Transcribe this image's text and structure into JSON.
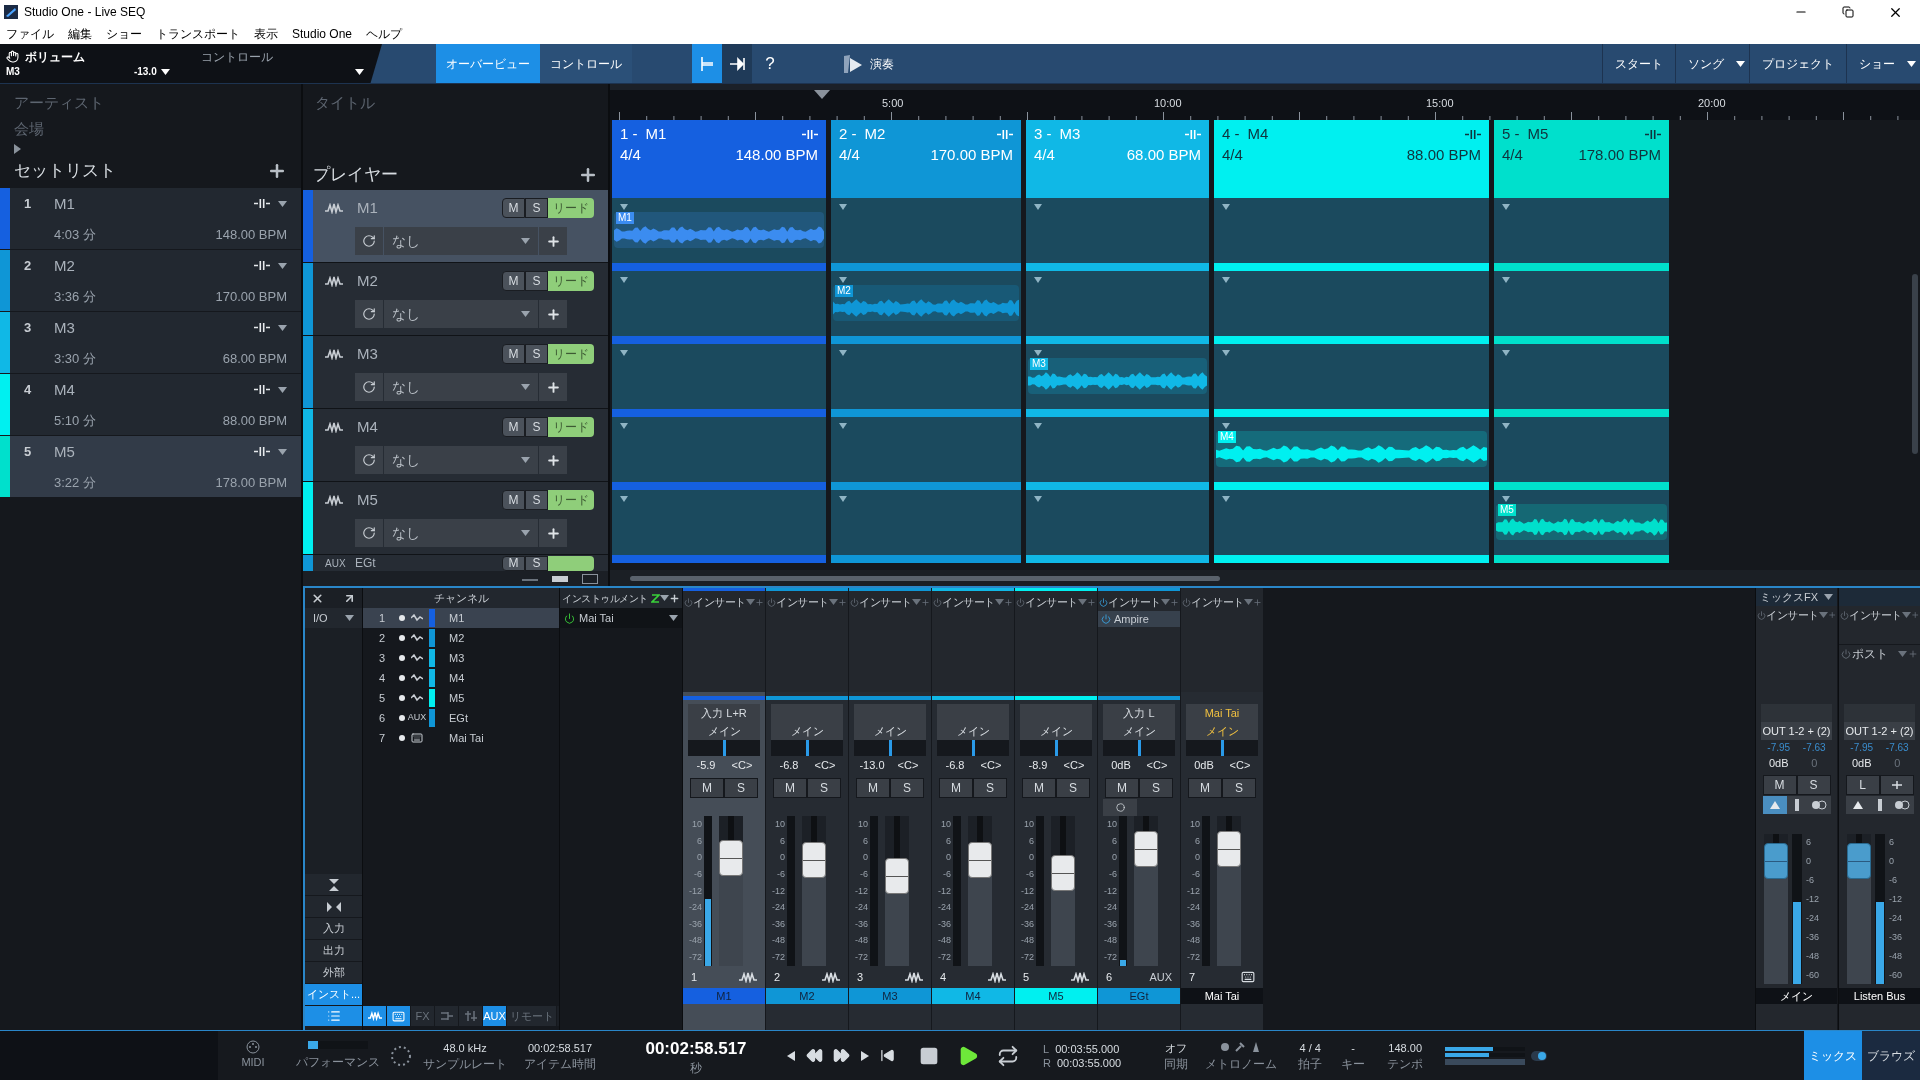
{
  "window": {
    "title": "Studio One - Live SEQ"
  },
  "menu": [
    "ファイル",
    "編集",
    "ショー",
    "トランスポート",
    "表示",
    "Studio One",
    "ヘルプ"
  ],
  "toolbar": {
    "parameter": "ボリューム",
    "track": "M3",
    "value": "-13.0",
    "control": "コントロール",
    "tabs": [
      {
        "label": "オーバービュー",
        "selected": true
      },
      {
        "label": "コントロール",
        "selected": false
      }
    ],
    "tools": [
      {
        "kind": "snap",
        "selected": true
      },
      {
        "kind": "follow",
        "selected": false
      }
    ],
    "help": "?",
    "perform": "演奏",
    "pages": [
      {
        "label": "スタート",
        "menu": false
      },
      {
        "label": "ソング",
        "menu": true
      },
      {
        "label": "プロジェクト",
        "menu": false
      },
      {
        "label": "ショー",
        "menu": true
      }
    ]
  },
  "show": {
    "artist_placeholder": "アーティスト",
    "venue_placeholder": "会場",
    "title_placeholder": "タイトル"
  },
  "setlist": {
    "title": "セットリスト",
    "items": [
      {
        "number": "1",
        "name": "M1",
        "duration": "4:03 分",
        "bpm": "148.00 BPM",
        "color": "#1560e0",
        "selected": false
      },
      {
        "number": "2",
        "name": "M2",
        "duration": "3:36 分",
        "bpm": "170.00 BPM",
        "color": "#0f96d6",
        "selected": false
      },
      {
        "number": "3",
        "name": "M3",
        "duration": "3:30 分",
        "bpm": "68.00 BPM",
        "color": "#10b8e6",
        "selected": false
      },
      {
        "number": "4",
        "name": "M4",
        "duration": "5:10 分",
        "bpm": "88.00 BPM",
        "color": "#00f0f0",
        "selected": false
      },
      {
        "number": "5",
        "name": "M5",
        "duration": "3:22 分",
        "bpm": "178.00 BPM",
        "color": "#00e0cc",
        "selected": true
      }
    ]
  },
  "players": {
    "title": "プレイヤー",
    "items": [
      {
        "name": "M1",
        "color": "#1560e0",
        "selected": true,
        "mute": "M",
        "solo": "S",
        "lead": "リード",
        "preset": "なし"
      },
      {
        "name": "M2",
        "color": "#0f96d6",
        "selected": false,
        "mute": "M",
        "solo": "S",
        "lead": "リード",
        "preset": "なし"
      },
      {
        "name": "M3",
        "color": "#0f96d6",
        "selected": false,
        "mute": "M",
        "solo": "S",
        "lead": "リード",
        "preset": "なし"
      },
      {
        "name": "M4",
        "color": "#10b8e6",
        "selected": false,
        "mute": "M",
        "solo": "S",
        "lead": "リード",
        "preset": "なし"
      },
      {
        "name": "M5",
        "color": "#00f0f0",
        "selected": false,
        "mute": "M",
        "solo": "S",
        "lead": "リード",
        "preset": "なし"
      }
    ],
    "partial": {
      "badge": "AUX",
      "name": "EGt",
      "mute": "M",
      "solo": "S",
      "color": "#0f96d6"
    }
  },
  "timeline": {
    "ruler": [
      "5:00",
      "10:00",
      "15:00",
      "20:00"
    ],
    "songs": [
      {
        "number": "1 -",
        "name": "M1",
        "meter": "4/4",
        "bpm": "148.00 BPM",
        "color": "#1560e0",
        "clip": "M1"
      },
      {
        "number": "2 -",
        "name": "M2",
        "meter": "4/4",
        "bpm": "170.00 BPM",
        "color": "#0f96d6",
        "clip": "M2"
      },
      {
        "number": "3 -",
        "name": "M3",
        "meter": "4/4",
        "bpm": "68.00 BPM",
        "color": "#10b8e6",
        "clip": "M3"
      },
      {
        "number": "4 -",
        "name": "M4",
        "meter": "4/4",
        "bpm": "88.00 BPM",
        "color": "#00f0f0",
        "clip": "M4"
      },
      {
        "number": "5 -",
        "name": "M5",
        "meter": "4/4",
        "bpm": "178.00 BPM",
        "color": "#00e0cc",
        "clip": "M5"
      }
    ]
  },
  "mixer": {
    "io": "I/O",
    "channel_header": "チャンネル",
    "instrument_header": "インストゥルメント",
    "instruments": [
      {
        "name": "Mai Tai",
        "on": true
      }
    ],
    "nav": [
      {
        "label": "入力",
        "selected": false
      },
      {
        "label": "出力",
        "selected": false
      },
      {
        "label": "外部",
        "selected": false
      },
      {
        "label": "インスト...",
        "selected": true
      }
    ],
    "filters": [
      {
        "kind": "audio",
        "selected": true
      },
      {
        "kind": "instrument",
        "selected": true
      },
      {
        "kind": "text",
        "label": "FX",
        "selected": false
      },
      {
        "kind": "bus",
        "selected": false
      },
      {
        "kind": "vca",
        "selected": false
      },
      {
        "kind": "text",
        "label": "AUX",
        "selected": true
      },
      {
        "kind": "text",
        "label": "リモート",
        "selected": false
      }
    ],
    "channels": [
      {
        "number": "1",
        "name": "M1",
        "kind": "audio",
        "color": "#1560e0",
        "selected": true
      },
      {
        "number": "2",
        "name": "M2",
        "kind": "audio",
        "color": "#0f96d6",
        "selected": false
      },
      {
        "number": "3",
        "name": "M3",
        "kind": "audio",
        "color": "#10b8e6",
        "selected": false
      },
      {
        "number": "4",
        "name": "M4",
        "kind": "audio",
        "color": "#10b8e6",
        "selected": false
      },
      {
        "number": "5",
        "name": "M5",
        "kind": "audio",
        "color": "#00f0f0",
        "selected": false
      },
      {
        "number": "6",
        "name": "EGt",
        "kind": "aux",
        "badge": "AUX",
        "color": "#0f96d6",
        "selected": false
      },
      {
        "number": "7",
        "name": "Mai Tai",
        "kind": "instrument",
        "selected": false
      }
    ],
    "strips": [
      {
        "insert": "インサート",
        "insert_on": false,
        "input": "入力 L+R",
        "output": "メイン",
        "volume": "-5.9",
        "pan": "<C>",
        "mute": "M",
        "solo": "S",
        "number": "1",
        "name": "M1",
        "kind": "audio",
        "color": "#1560e0",
        "selected": true,
        "level": 0.72,
        "meter": {
          "level": 0.45
        },
        "scale": [
          "10",
          "6",
          "0",
          "-6",
          "-12",
          "-24",
          "-36",
          "-48",
          "-72"
        ]
      },
      {
        "insert": "インサート",
        "insert_on": false,
        "output": "メイン",
        "volume": "-6.8",
        "pan": "<C>",
        "mute": "M",
        "solo": "S",
        "number": "2",
        "name": "M2",
        "kind": "audio",
        "color": "#0f96d6",
        "selected": false,
        "level": 0.71,
        "scale": [
          "10",
          "6",
          "0",
          "-6",
          "-12",
          "-24",
          "-36",
          "-48",
          "-72"
        ]
      },
      {
        "insert": "インサート",
        "insert_on": false,
        "output": "メイン",
        "volume": "-13.0",
        "pan": "<C>",
        "mute": "M",
        "solo": "S",
        "number": "3",
        "name": "M3",
        "kind": "audio",
        "color": "#0f96d6",
        "selected": false,
        "level": 0.6,
        "scale": [
          "10",
          "6",
          "0",
          "-6",
          "-12",
          "-24",
          "-36",
          "-48",
          "-72"
        ]
      },
      {
        "insert": "インサート",
        "insert_on": false,
        "output": "メイン",
        "volume": "-6.8",
        "pan": "<C>",
        "mute": "M",
        "solo": "S",
        "number": "4",
        "name": "M4",
        "kind": "audio",
        "color": "#10b8e6",
        "selected": false,
        "level": 0.71,
        "scale": [
          "10",
          "6",
          "0",
          "-6",
          "-12",
          "-24",
          "-36",
          "-48",
          "-72"
        ]
      },
      {
        "insert": "インサート",
        "insert_on": false,
        "output": "メイン",
        "volume": "-8.9",
        "pan": "<C>",
        "mute": "M",
        "solo": "S",
        "number": "5",
        "name": "M5",
        "kind": "audio",
        "color": "#00f0f0",
        "selected": false,
        "level": 0.62,
        "scale": [
          "10",
          "6",
          "0",
          "-6",
          "-12",
          "-24",
          "-36",
          "-48",
          "-72"
        ]
      },
      {
        "insert": "インサート",
        "insert_on": true,
        "plugins": [
          "Ampire"
        ],
        "input": "入力 L",
        "output": "メイン",
        "volume": "0dB",
        "pan": "<C>",
        "mute": "M",
        "solo": "S",
        "number": "6",
        "name": "EGt",
        "kind": "aux",
        "badge": "AUX",
        "color": "#0f96d6",
        "selected": false,
        "level": 0.78,
        "meter": {
          "level": 0.04
        },
        "scale": [
          "10",
          "6",
          "0",
          "-6",
          "-12",
          "-24",
          "-36",
          "-48",
          "-72"
        ]
      },
      {
        "insert": "インサート",
        "insert_on": false,
        "input": "Mai Tai",
        "output": "メイン",
        "volume": "0dB",
        "pan": "<C>",
        "mute": "M",
        "solo": "S",
        "number": "7",
        "name": "Mai Tai",
        "kind": "instrument",
        "selected": false,
        "level": 0.78,
        "scale": [
          "10",
          "6",
          "0",
          "-6",
          "-12",
          "-24",
          "-36",
          "-48",
          "-72"
        ]
      }
    ],
    "buses": [
      {
        "kind": "main",
        "header": "ミックスFX",
        "insert": "インサート",
        "output": "OUT 1-2 + (2)",
        "peak_l": "-7.95",
        "peak_r": "-7.63",
        "volume": "0dB",
        "pan": "0",
        "buttons": [
          "M",
          "S"
        ],
        "name": "メイン",
        "level": 0.82,
        "meter": {
          "level": 0.55
        },
        "scale": [
          "6",
          "0",
          "-6",
          "-12",
          "-24",
          "-36",
          "-48",
          "-60"
        ]
      },
      {
        "kind": "listen",
        "insert": "インサート",
        "post": "ポスト",
        "output": "OUT 1-2 + (2)",
        "peak_l": "-7.95",
        "peak_r": "-7.63",
        "volume": "0dB",
        "pan": "0",
        "buttons": [
          "L"
        ],
        "name": "Listen Bus",
        "level": 0.82,
        "meter": {
          "level": 0.55
        },
        "scale": [
          "6",
          "0",
          "-6",
          "-12",
          "-24",
          "-36",
          "-48",
          "-60"
        ]
      }
    ]
  },
  "transport": {
    "midi": "MIDI",
    "performance": "パフォーマンス",
    "sample_rate": "48.0 kHz",
    "sample_rate_label": "サンプルレート",
    "item_time": "00:02:58.517",
    "item_time_label": "アイテム時間",
    "position": "00:02:58.517",
    "position_unit": "秒",
    "loop": [
      {
        "label": "L",
        "time": "00:03:55.000"
      },
      {
        "label": "R",
        "time": "00:03:55.000"
      }
    ],
    "sync": "オフ",
    "sync_label": "同期",
    "metronome_label": "メトロノーム",
    "time_signature": "4 / 4",
    "time_signature_label": "拍子",
    "key": "-",
    "key_label": "キー",
    "tempo": "148.00",
    "tempo_label": "テンポ",
    "views": [
      {
        "label": "ミックス",
        "selected": true
      },
      {
        "label": "ブラウズ",
        "selected": false
      }
    ]
  }
}
